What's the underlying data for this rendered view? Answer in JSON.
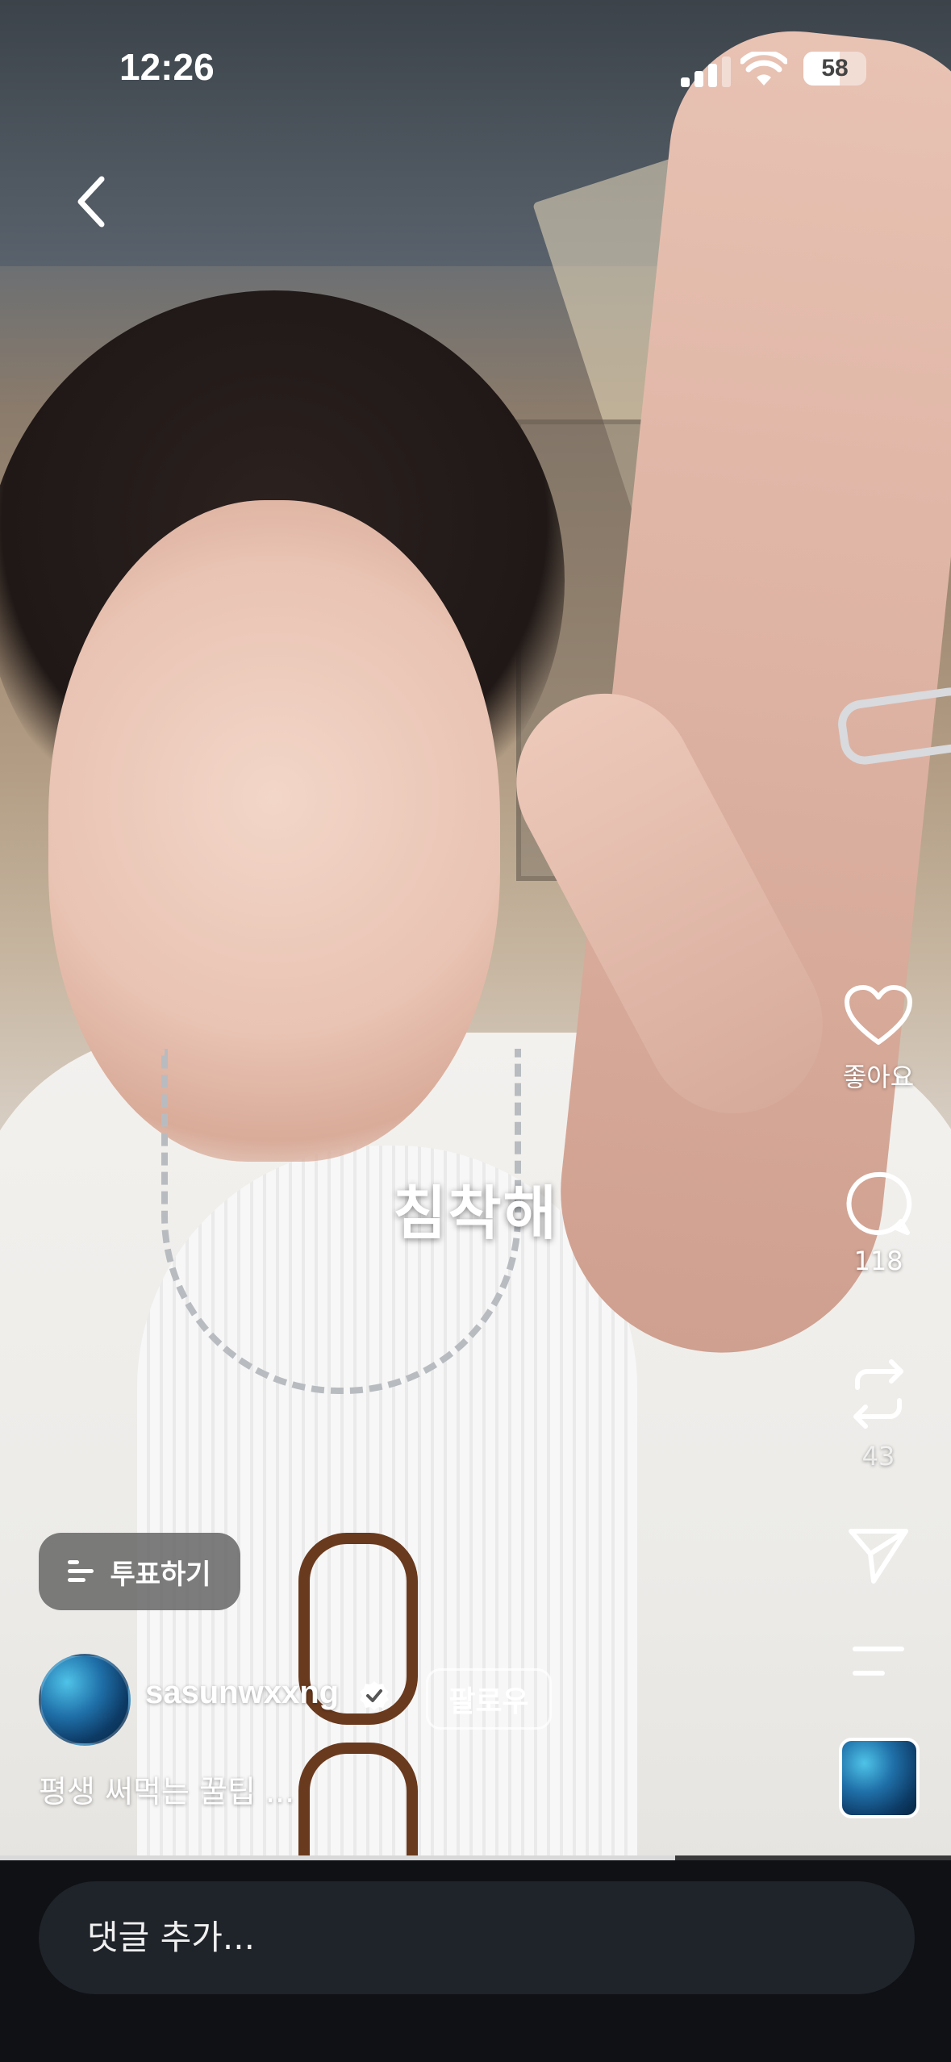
{
  "status_bar": {
    "time": "12:26",
    "battery": "58",
    "battery_level": 0.58
  },
  "caption": "침착해",
  "actions": {
    "like_label": "좋아요",
    "comment_count": "118",
    "repost_count": "43"
  },
  "poll_label": "투표하기",
  "author": {
    "username": "sasunwxxng",
    "follow_label": "팔로우"
  },
  "description": "평생 써먹는 꿀팁 ...",
  "video_progress": 0.71,
  "comment_input": {
    "placeholder": "댓글 추가..."
  },
  "colors": {
    "bottom_bar": "#0f1115",
    "comment_field": "#1f242a",
    "verified_badge": "#ffffff"
  }
}
